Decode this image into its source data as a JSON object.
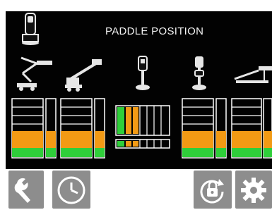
{
  "header": {
    "title": "PADDLE POSITION"
  },
  "colors": {
    "screen_bg": "#020202",
    "green": "#2fce3a",
    "orange": "#f29a14",
    "white": "#ffffff",
    "button_gray": "#8d8d8d"
  },
  "icons": {
    "controller": "joystick-controller-icon",
    "machines": [
      "articulating-boom-lift-icon",
      "telescopic-boom-lift-icon",
      "paddle-neutral-icon",
      "paddle-forward-icon",
      "trailer-lift-icon"
    ]
  },
  "bottom_buttons": [
    "wrench-icon",
    "clock-icon",
    "lock-icon",
    "gear-icon"
  ],
  "levels": {
    "meters": [
      {
        "name": "meter-1",
        "orange": 0.27,
        "green": 0.2
      },
      {
        "name": "meter-2",
        "orange": 0.27,
        "green": 0.2
      },
      {
        "name": "meter-4",
        "orange": 0.27,
        "green": 0.2
      },
      {
        "name": "meter-5",
        "orange": 0.27,
        "green": 0.2
      }
    ]
  }
}
